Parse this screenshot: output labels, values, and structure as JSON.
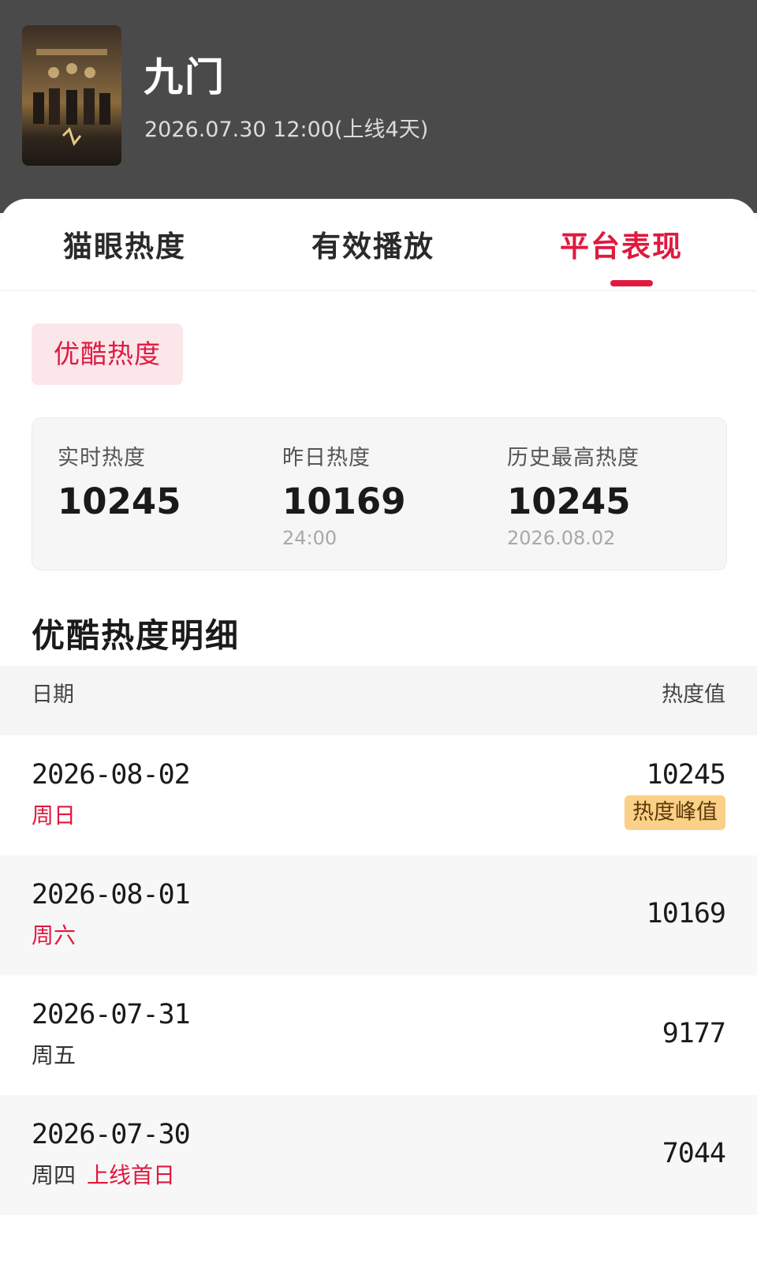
{
  "show": {
    "title": "九门",
    "subtitle": "2026.07.30 12:00(上线4天)"
  },
  "tabs": [
    {
      "label": "猫眼热度",
      "active": false
    },
    {
      "label": "有效播放",
      "active": false
    },
    {
      "label": "平台表现",
      "active": true
    }
  ],
  "platform_chip": "优酷热度",
  "stats": [
    {
      "label": "实时热度",
      "value": "10245",
      "note": ""
    },
    {
      "label": "昨日热度",
      "value": "10169",
      "note": "24:00"
    },
    {
      "label": "历史最高热度",
      "value": "10245",
      "note": "2026.08.02"
    }
  ],
  "detail": {
    "title": "优酷热度明细",
    "col_date": "日期",
    "col_value": "热度值"
  },
  "rows": [
    {
      "date": "2026-08-02",
      "weekday": "周日",
      "weekday_red": true,
      "tag": "",
      "value": "10245",
      "badge": "热度峰值"
    },
    {
      "date": "2026-08-01",
      "weekday": "周六",
      "weekday_red": true,
      "tag": "",
      "value": "10169",
      "badge": ""
    },
    {
      "date": "2026-07-31",
      "weekday": "周五",
      "weekday_red": false,
      "tag": "",
      "value": "9177",
      "badge": ""
    },
    {
      "date": "2026-07-30",
      "weekday": "周四",
      "weekday_red": false,
      "tag": "上线首日",
      "value": "7044",
      "badge": ""
    }
  ],
  "colors": {
    "accent": "#e0193f",
    "header_bg": "#4a4a4a",
    "chip_bg": "#fbe6ea",
    "badge_bg": "#fbd087"
  }
}
